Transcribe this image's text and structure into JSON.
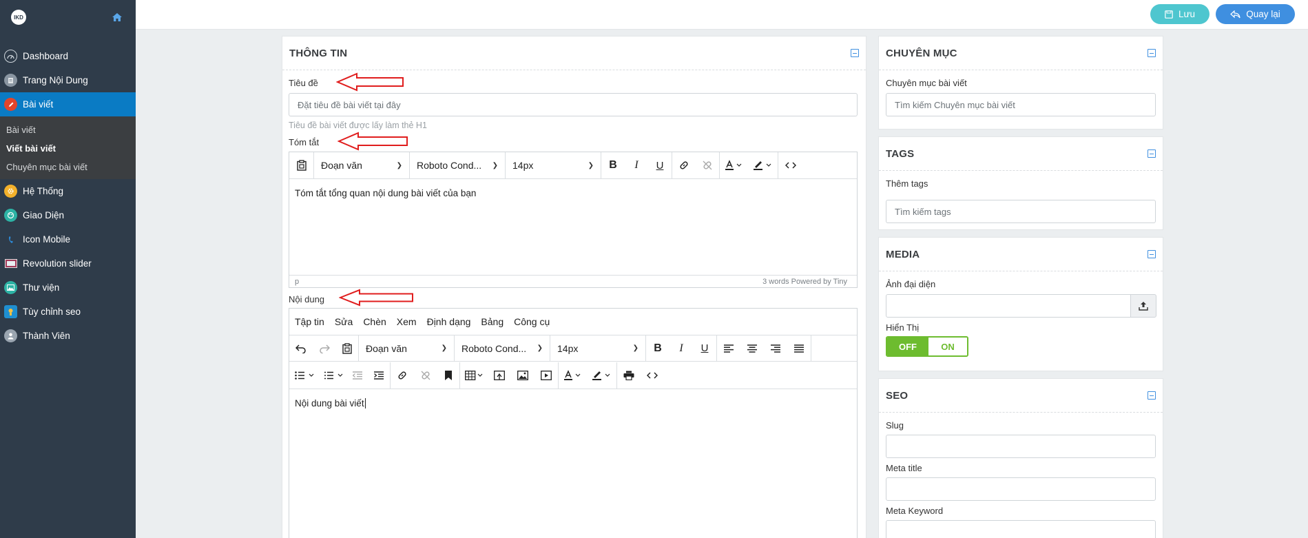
{
  "sidebar": {
    "logo": "IKD",
    "items": [
      {
        "label": "Dashboard",
        "icon": "speedometer-icon"
      },
      {
        "label": "Trang Nội Dung",
        "icon": "page-icon"
      },
      {
        "label": "Bài viết",
        "icon": "edit-icon"
      },
      {
        "label": "Hệ Thống",
        "icon": "gear-icon"
      },
      {
        "label": "Giao Diện",
        "icon": "palette-icon"
      },
      {
        "label": "Icon Mobile",
        "icon": "phone-icon"
      },
      {
        "label": "Revolution slider",
        "icon": "slider-icon"
      },
      {
        "label": "Thư viện",
        "icon": "image-icon"
      },
      {
        "label": "Tùy chỉnh seo",
        "icon": "seo-icon"
      },
      {
        "label": "Thành Viên",
        "icon": "user-icon"
      }
    ],
    "sub_items": [
      {
        "label": "Bài viết"
      },
      {
        "label": "Viết bài viết"
      },
      {
        "label": "Chuyên mục bài viết"
      }
    ]
  },
  "topbar": {
    "save_label": "Lưu",
    "back_label": "Quay lại",
    "save_color": "#4ec6cf",
    "back_color": "#3f8fe0"
  },
  "thong_tin": {
    "title": "THÔNG TIN",
    "tieu_de_label": "Tiêu đề",
    "tieu_de_placeholder": "Đặt tiêu đề bài viết tại đây",
    "tieu_de_hint": "Tiêu đề bài viết được lấy làm thẻ H1",
    "tom_tat_label": "Tóm tắt",
    "noi_dung_label": "Nội dung"
  },
  "summary_editor": {
    "block_format": "Đoạn văn",
    "font_family": "Roboto Cond...",
    "font_size": "14px",
    "content": "Tóm tắt tổng quan nội dung bài viết của bạn",
    "status_path": "p",
    "status_right": "3 words  Powered by Tiny"
  },
  "content_editor": {
    "menus": [
      "Tập tin",
      "Sửa",
      "Chèn",
      "Xem",
      "Định dạng",
      "Bảng",
      "Công cụ"
    ],
    "block_format": "Đoạn văn",
    "font_family": "Roboto Cond...",
    "font_size": "14px",
    "content": "Nội dung bài viết"
  },
  "chuyen_muc": {
    "title": "CHUYÊN MỤC",
    "label": "Chuyên mục bài viết",
    "placeholder": "Tìm kiếm Chuyên mục bài viết"
  },
  "tags": {
    "title": "TAGS",
    "label": "Thêm tags",
    "placeholder": "Tìm kiếm tags"
  },
  "media": {
    "title": "MEDIA",
    "image_label": "Ảnh đại diện",
    "display_label": "Hiển Thị",
    "toggle_off": "OFF",
    "toggle_on": "ON",
    "toggle_color": "#6dbc2f"
  },
  "seo": {
    "title": "SEO",
    "slug_label": "Slug",
    "meta_title_label": "Meta title",
    "meta_keyword_label": "Meta Keyword"
  }
}
